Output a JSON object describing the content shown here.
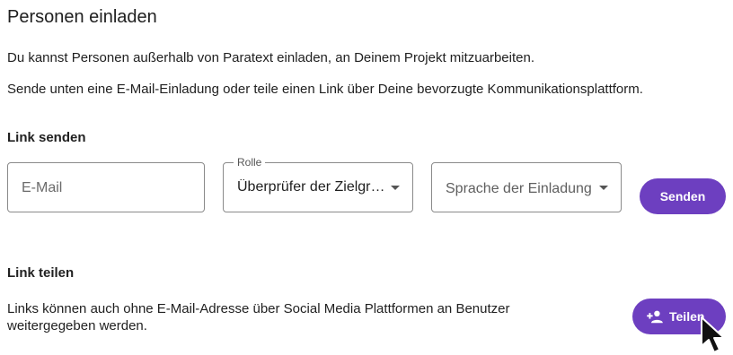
{
  "header": {
    "title": "Personen einladen",
    "description_1": "Du kannst Personen außerhalb von Paratext einladen, an Deinem Projekt mitzuarbeiten.",
    "description_2": "Sende unten eine E-Mail-Einladung oder teile einen Link über Deine bevorzugte Kommunikationsplattform."
  },
  "send_section": {
    "heading": "Link senden",
    "email_placeholder": "E-Mail",
    "role_label": "Rolle",
    "role_value": "Überprüfer der Zielgruppe",
    "language_placeholder": "Sprache der Einladung",
    "send_button": "Senden"
  },
  "share_section": {
    "heading": "Link teilen",
    "text": "Links können auch ohne E-Mail-Adresse über Social Media Plattformen an Benutzer weitergegeben werden.",
    "share_button": "Teilen",
    "share_icon": "person-add-icon"
  },
  "colors": {
    "accent": "#6d3fc0",
    "border": "#8a8a8a"
  }
}
